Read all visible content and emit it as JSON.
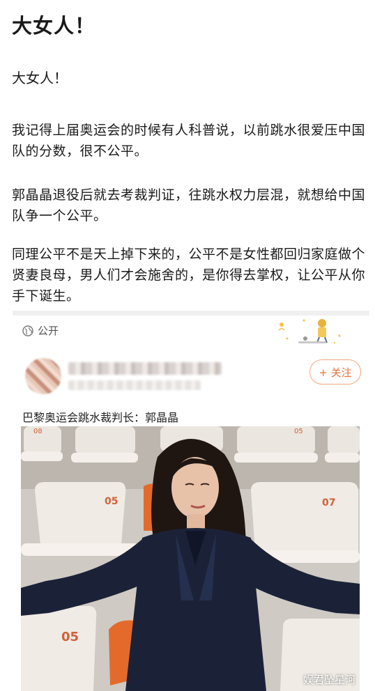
{
  "post": {
    "title": "大女人！",
    "subtitle": "大女人！",
    "paragraphs": [
      "我记得上届奥运会的时候有人科普说，以前跳水很爱压中国队的分数，很不公平。",
      "郭晶晶退役后就去考裁判证，往跳水权力层混，就想给中国队争一个公平。",
      "同理公平不是天上掉下来的，公平不是女性都回归家庭做个贤妻良母，男人们才会施舍的，是你得去掌权，让公平从你手下诞生。"
    ],
    "visibility_label": "公开"
  },
  "embedded": {
    "follow_label": "+ 关注",
    "caption": "巴黎奥运会跳水裁判长：郭晶晶",
    "photo": {
      "seat_numbers": [
        "08",
        "05",
        "05",
        "07",
        "05",
        "07"
      ],
      "seat_color": "#efe9e4",
      "accent_seat_color": "#e46a2c",
      "suit_color": "#1b2238"
    }
  },
  "watermark": "娱君坠星河"
}
